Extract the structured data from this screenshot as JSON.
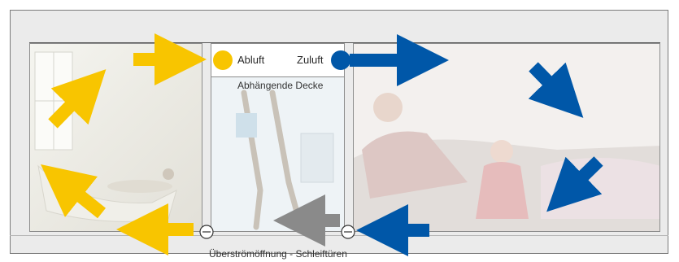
{
  "labels": {
    "exhaust": "Abluft",
    "supply": "Zuluft",
    "suspended_ceiling": "Abhängende Decke",
    "transfer_opening": "Überströmöffnung - Schleiftüren"
  },
  "colors": {
    "exhaust_arrow": "#f8c500",
    "supply_arrow": "#0057a8",
    "transfer_arrow": "#8a8a8a"
  }
}
